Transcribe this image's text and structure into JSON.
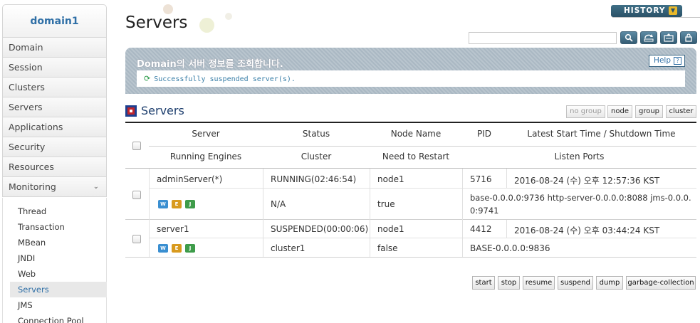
{
  "sidebar": {
    "domain": "domain1",
    "items": [
      {
        "label": "Domain"
      },
      {
        "label": "Session"
      },
      {
        "label": "Clusters"
      },
      {
        "label": "Servers"
      },
      {
        "label": "Applications"
      },
      {
        "label": "Security"
      },
      {
        "label": "Resources"
      },
      {
        "label": "Monitoring"
      }
    ],
    "monitoring_items": [
      {
        "label": "Thread"
      },
      {
        "label": "Transaction"
      },
      {
        "label": "MBean"
      },
      {
        "label": "JNDI"
      },
      {
        "label": "Web"
      },
      {
        "label": "Servers"
      },
      {
        "label": "JMS"
      },
      {
        "label": "Connection Pool"
      }
    ]
  },
  "header": {
    "title": "Servers",
    "history_label": "HISTORY",
    "search_placeholder": ""
  },
  "toolbar": {
    "icons": [
      "search-icon",
      "refresh-icon",
      "export-icon",
      "lock-icon"
    ]
  },
  "info": {
    "title": "Domain의 서버 정보를 조회합니다.",
    "help_label": "Help",
    "message": "Successfully suspended server(s)."
  },
  "section": {
    "title": "Servers",
    "view_buttons": [
      "no group",
      "node",
      "group",
      "cluster"
    ]
  },
  "table": {
    "headers_row1": [
      "Server",
      "Status",
      "Node Name",
      "PID",
      "Latest Start Time / Shutdown Time"
    ],
    "headers_row2": [
      "Running Engines",
      "Cluster",
      "Need to Restart",
      "Listen Ports"
    ],
    "rows": [
      {
        "server": "adminServer(*)",
        "status": "RUNNING(02:46:54)",
        "node": "node1",
        "pid": "5716",
        "time": "2016-08-24 (수) 오후 12:57:36 KST",
        "cluster": "N/A",
        "restart": "true",
        "ports_line1": "base-0.0.0.0:9736  http-server-0.0.0.0:8088  jms-0.0.0.",
        "ports_line2": "0:9741"
      },
      {
        "server": "server1",
        "status": "SUSPENDED(00:00:06)",
        "node": "node1",
        "pid": "4412",
        "time": "2016-08-24 (수) 오후 03:44:24 KST",
        "cluster": "cluster1",
        "restart": "false",
        "ports_line1": "BASE-0.0.0.0:9836",
        "ports_line2": ""
      }
    ]
  },
  "actions": [
    "start",
    "stop",
    "resume",
    "suspend",
    "dump",
    "garbage-collection"
  ],
  "colors": {
    "accent": "#2f6fa6",
    "history": "#2a5167",
    "section_title": "#1e3f6e"
  }
}
